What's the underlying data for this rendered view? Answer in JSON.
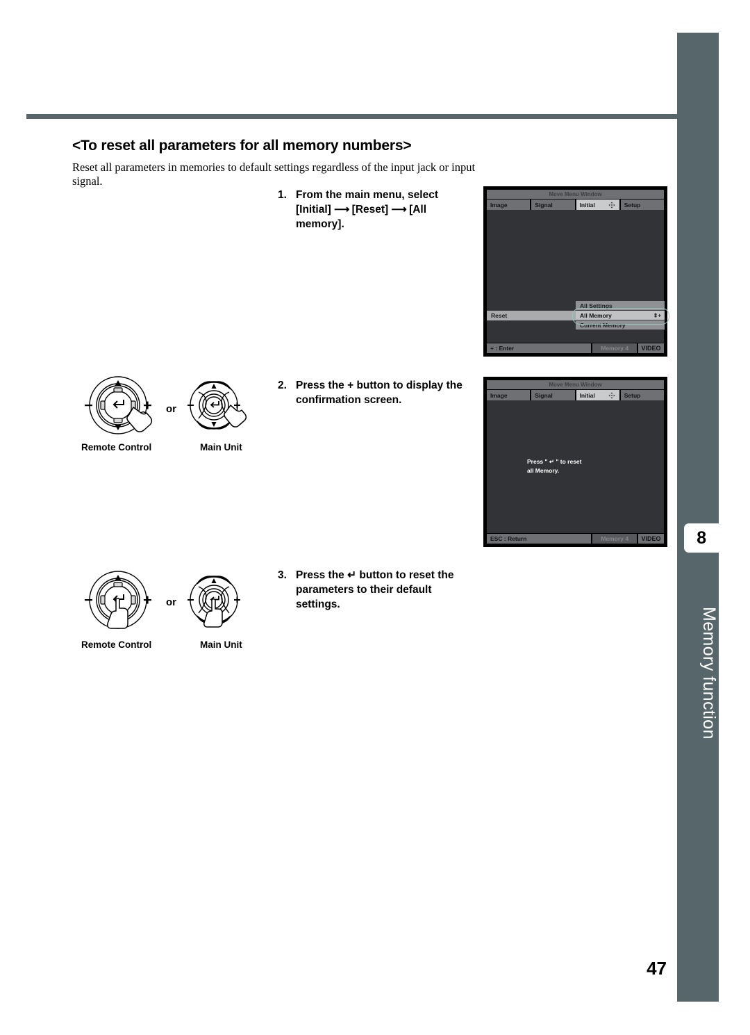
{
  "page": {
    "number": "47",
    "chapter_badge": "8",
    "chapter_title": "Memory function",
    "accent_color": "#56666a"
  },
  "section": {
    "heading": "<To reset all parameters for all memory numbers>",
    "intro": "Reset all parameters in memories to default settings regardless of the input jack or input signal."
  },
  "steps": [
    {
      "number": "1.",
      "line1": "From the main menu, select",
      "line2_pre": "[Initial]",
      "arrow": "⟶",
      "line2_mid": "[Reset]",
      "line2_post": "[All",
      "line3": "memory]."
    },
    {
      "number": "2.",
      "line1": "Press the + button to display the",
      "line2": "confirmation screen."
    },
    {
      "number": "3.",
      "line1_pre": "Press the",
      "glyph": "↵",
      "line1_post": "button to reset the",
      "line2": "parameters to their default",
      "line3": "settings."
    }
  ],
  "diagrams": {
    "or_label": "or",
    "remote_control_caption": "Remote Control",
    "main_unit_caption": "Main Unit",
    "minus_label": "−",
    "plus_label": "+",
    "enter_glyph": "↵"
  },
  "osd_screens": [
    {
      "title": "Move Menu Window",
      "tabs": [
        {
          "label": "Image",
          "active": false
        },
        {
          "label": "Signal",
          "active": false
        },
        {
          "label": "Initial",
          "active": true
        },
        {
          "label": "Setup",
          "active": false
        }
      ],
      "menu_row": "Reset",
      "dropdown": [
        {
          "label": "All Settings",
          "selected": false
        },
        {
          "label": "All Memory",
          "selected": true
        },
        {
          "label": "Current Memory",
          "selected": false
        }
      ],
      "footer_left": "+ : Enter",
      "footer_mid": "Memory 4",
      "footer_right": "VIDEO"
    },
    {
      "title": "Move Menu Window",
      "tabs": [
        {
          "label": "Image",
          "active": false
        },
        {
          "label": "Signal",
          "active": false
        },
        {
          "label": "Initial",
          "active": true
        },
        {
          "label": "Setup",
          "active": false
        }
      ],
      "confirm_line1": "Press \" ↵ \" to reset",
      "confirm_line2": "all Memory.",
      "footer_left": "ESC : Return",
      "footer_mid": "Memory 4",
      "footer_right": "VIDEO"
    }
  ]
}
